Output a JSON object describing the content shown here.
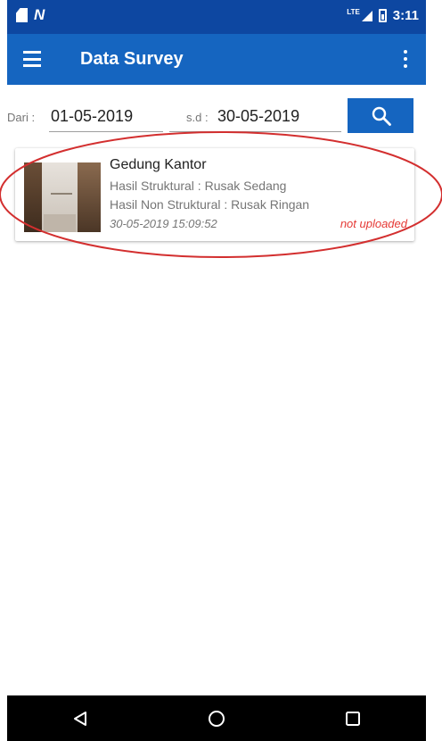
{
  "status_bar": {
    "network": "N",
    "lte": "LTE",
    "time": "3:11"
  },
  "toolbar": {
    "menu_icon": "menu-icon",
    "title": "Data Survey",
    "more_icon": "more-vert-icon"
  },
  "filter": {
    "from_label": "Dari :",
    "from_value": "01-05-2019",
    "to_label": "s.d :",
    "to_value": "30-05-2019",
    "search_icon": "search-icon"
  },
  "survey_items": [
    {
      "title": "Gedung Kantor",
      "structural": "Hasil Struktural : Rusak Sedang",
      "non_structural": "Hasil Non Struktural : Rusak Ringan",
      "timestamp": "30-05-2019 15:09:52",
      "status": "not uploaded"
    }
  ],
  "nav_bar": {
    "back_icon": "back-triangle-icon",
    "home_icon": "home-circle-icon",
    "recents_icon": "recents-square-icon"
  },
  "colors": {
    "status_bar": "#0d47a1",
    "toolbar": "#1565c0",
    "not_uploaded": "#e53935",
    "annotation": "#d32f2f"
  }
}
